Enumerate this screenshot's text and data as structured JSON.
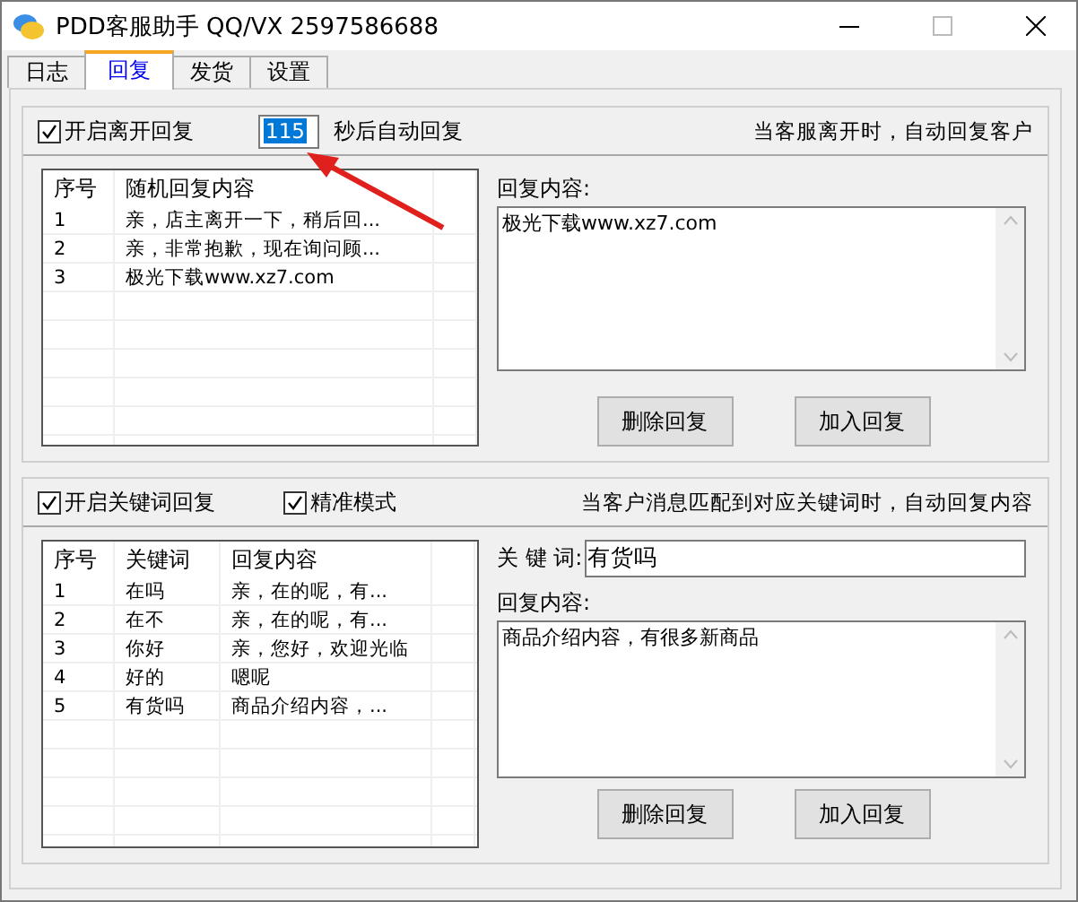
{
  "window": {
    "title": "PDD客服助手 QQ/VX 2597586688"
  },
  "tabs": [
    {
      "label": "日志",
      "selected": false
    },
    {
      "label": "回复",
      "selected": true
    },
    {
      "label": "发货",
      "selected": false
    },
    {
      "label": "设置",
      "selected": false
    }
  ],
  "away_reply": {
    "enable_label": "开启离开回复",
    "checked": true,
    "seconds": "115",
    "seconds_label": "秒后自动回复",
    "hint": "当客服离开时，自动回复客户",
    "table": {
      "columns": [
        "序号",
        "随机回复内容"
      ],
      "rows": [
        [
          "1",
          "亲，店主离开一下，稍后回..."
        ],
        [
          "2",
          "亲，非常抱歉，现在询问顾..."
        ],
        [
          "3",
          "极光下载www.xz7.com"
        ]
      ]
    },
    "content_label": "回复内容:",
    "content": "极光下载www.xz7.com",
    "buttons": [
      "删除回复",
      "加入回复"
    ]
  },
  "keyword_reply": {
    "enable_label": "开启关键词回复",
    "checked": true,
    "exact_label": "精准模式",
    "exact_checked": true,
    "hint": "当客户消息匹配到对应关键词时，自动回复内容",
    "table": {
      "columns": [
        "序号",
        "关键词",
        "回复内容"
      ],
      "rows": [
        [
          "1",
          "在吗",
          "亲，在的呢，有..."
        ],
        [
          "2",
          "在不",
          "亲，在的呢，有..."
        ],
        [
          "3",
          "你好",
          "亲，您好，欢迎光临"
        ],
        [
          "4",
          "好的",
          "嗯呢"
        ],
        [
          "5",
          "有货吗",
          "商品介绍内容，..."
        ]
      ]
    },
    "keyword_label": "关 键 词:",
    "keyword": "有货吗",
    "content_label": "回复内容:",
    "content": "商品介绍内容，有很多新商品",
    "buttons": [
      "删除回复",
      "加入回复"
    ]
  }
}
